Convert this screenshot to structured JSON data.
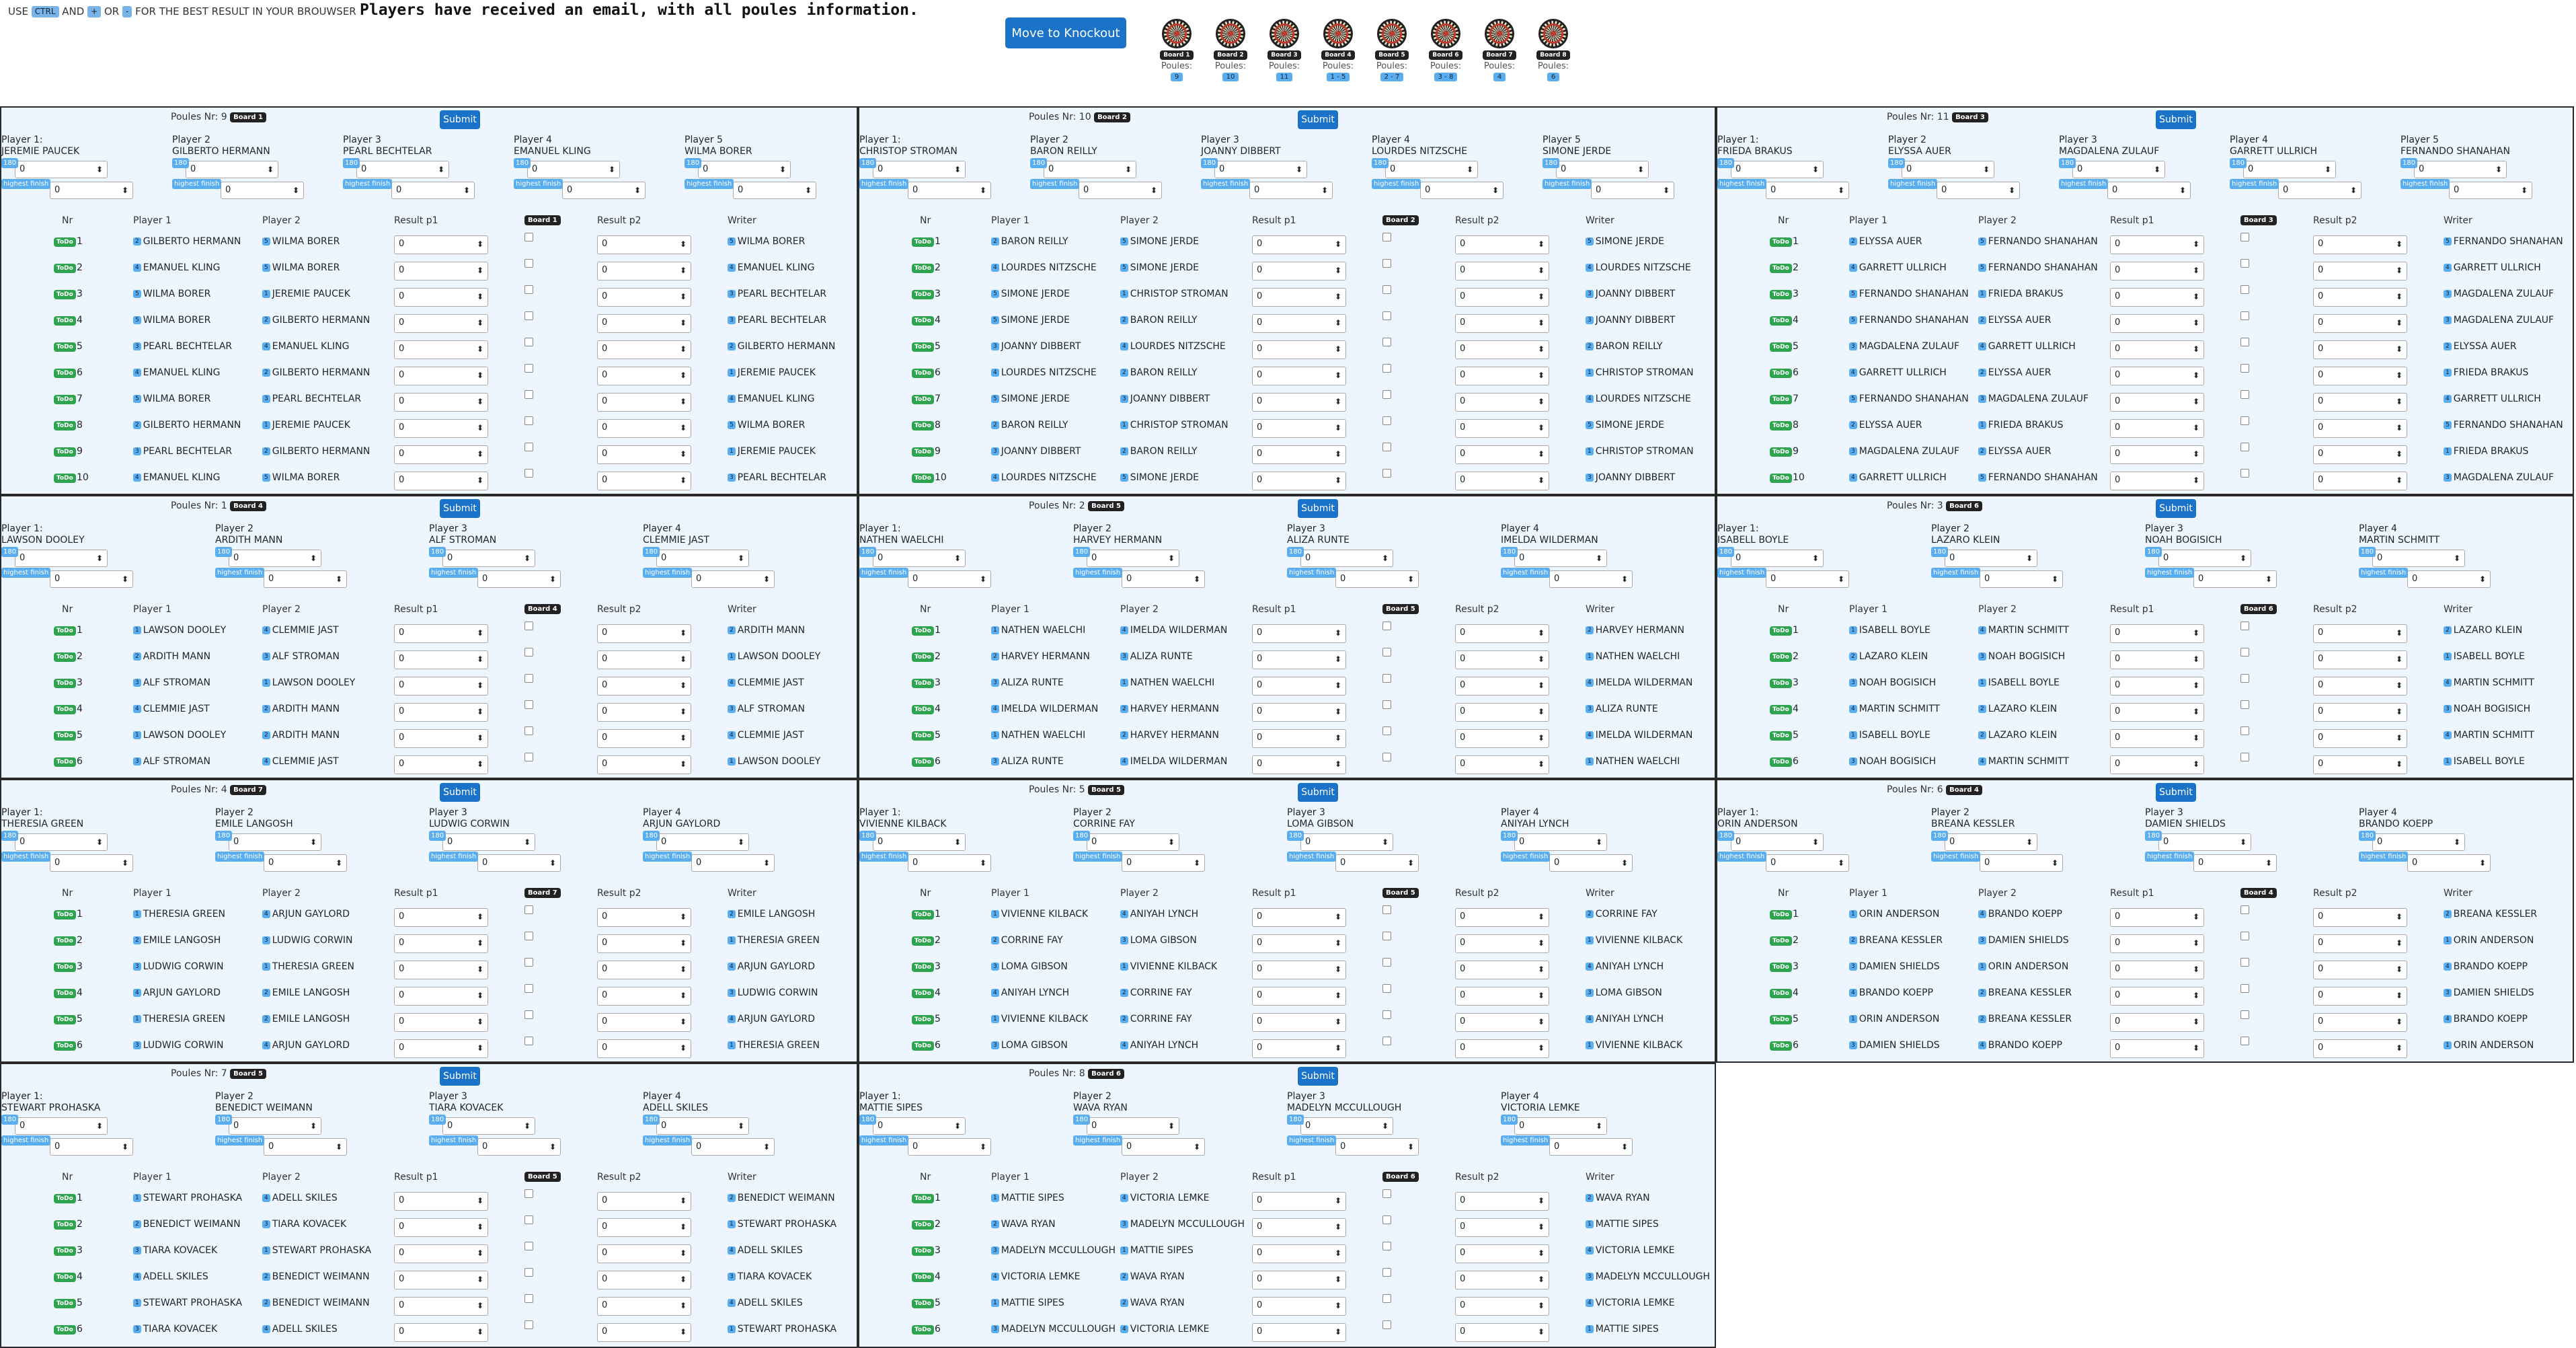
{
  "topbar": {
    "hint_use": "USE",
    "hint_key1": "CTRL",
    "hint_and": "AND",
    "hint_key2": "+",
    "hint_or": "OR",
    "hint_key3": "-",
    "hint_rest": "FOR THE BEST RESULT IN YOUR BROUWSER",
    "notice": "Players have received an email, with all poules information.",
    "move_button": "Move to Knockout"
  },
  "boards": [
    {
      "name": "Board 1",
      "label": "Poules:",
      "poules": "9"
    },
    {
      "name": "Board 2",
      "label": "Poules:",
      "poules": "10"
    },
    {
      "name": "Board 3",
      "label": "Poules:",
      "poules": "11"
    },
    {
      "name": "Board 4",
      "label": "Poules:",
      "poules": "1 - 5"
    },
    {
      "name": "Board 5",
      "label": "Poules:",
      "poules": "2 - 7"
    },
    {
      "name": "Board 6",
      "label": "Poules:",
      "poules": "3 - 8"
    },
    {
      "name": "Board 7",
      "label": "Poules:",
      "poules": "4"
    },
    {
      "name": "Board 8",
      "label": "Poules:",
      "poules": "6"
    }
  ],
  "labels": {
    "poules_nr": "Poules Nr:",
    "submit": "Submit",
    "nr": "Nr",
    "player1": "Player 1",
    "player2": "Player 2",
    "result_p1": "Result p1",
    "result_p2": "Result p2",
    "writer": "Writer",
    "s180": "180",
    "highest_finish": "highest finish",
    "todo": "ToDo",
    "zero": "0"
  },
  "poules": [
    {
      "nr": "9",
      "board": "Board 1",
      "players": [
        "JEREMIE PAUCEK",
        "GILBERTO HERMANN",
        "PEARL BECHTELAR",
        "EMANUEL KLING",
        "WILMA BORER"
      ],
      "matches": [
        [
          1,
          2,
          5,
          5
        ],
        [
          2,
          4,
          5,
          4
        ],
        [
          3,
          5,
          1,
          3
        ],
        [
          4,
          5,
          2,
          3
        ],
        [
          5,
          3,
          4,
          2
        ],
        [
          6,
          4,
          2,
          1
        ],
        [
          7,
          5,
          3,
          4
        ],
        [
          8,
          2,
          1,
          5
        ],
        [
          9,
          3,
          2,
          1
        ],
        [
          10,
          4,
          5,
          3
        ]
      ]
    },
    {
      "nr": "10",
      "board": "Board 2",
      "players": [
        "CHRISTOP STROMAN",
        "BARON REILLY",
        "JOANNY DIBBERT",
        "LOURDES NITZSCHE",
        "SIMONE JERDE"
      ],
      "matches": [
        [
          1,
          2,
          5,
          5
        ],
        [
          2,
          4,
          5,
          4
        ],
        [
          3,
          5,
          1,
          3
        ],
        [
          4,
          5,
          2,
          3
        ],
        [
          5,
          3,
          4,
          2
        ],
        [
          6,
          4,
          2,
          1
        ],
        [
          7,
          5,
          3,
          4
        ],
        [
          8,
          2,
          1,
          5
        ],
        [
          9,
          3,
          2,
          1
        ],
        [
          10,
          4,
          5,
          3
        ]
      ]
    },
    {
      "nr": "11",
      "board": "Board 3",
      "players": [
        "FRIEDA BRAKUS",
        "ELYSSA AUER",
        "MAGDALENA ZULAUF",
        "GARRETT ULLRICH",
        "FERNANDO SHANAHAN"
      ],
      "matches": [
        [
          1,
          2,
          5,
          5
        ],
        [
          2,
          4,
          5,
          4
        ],
        [
          3,
          5,
          1,
          3
        ],
        [
          4,
          5,
          2,
          3
        ],
        [
          5,
          3,
          4,
          2
        ],
        [
          6,
          4,
          2,
          1
        ],
        [
          7,
          5,
          3,
          4
        ],
        [
          8,
          2,
          1,
          5
        ],
        [
          9,
          3,
          2,
          1
        ],
        [
          10,
          4,
          5,
          3
        ]
      ]
    },
    {
      "nr": "1",
      "board": "Board 4",
      "players": [
        "LAWSON DOOLEY",
        "ARDITH MANN",
        "ALF STROMAN",
        "CLEMMIE JAST"
      ],
      "matches": [
        [
          1,
          1,
          4,
          2
        ],
        [
          2,
          2,
          3,
          1
        ],
        [
          3,
          3,
          1,
          4
        ],
        [
          4,
          4,
          2,
          3
        ],
        [
          5,
          1,
          2,
          4
        ],
        [
          6,
          3,
          4,
          1
        ]
      ]
    },
    {
      "nr": "2",
      "board": "Board 5",
      "players": [
        "NATHEN WAELCHI",
        "HARVEY HERMANN",
        "ALIZA RUNTE",
        "IMELDA WILDERMAN"
      ],
      "matches": [
        [
          1,
          1,
          4,
          2
        ],
        [
          2,
          2,
          3,
          1
        ],
        [
          3,
          3,
          1,
          4
        ],
        [
          4,
          4,
          2,
          3
        ],
        [
          5,
          1,
          2,
          4
        ],
        [
          6,
          3,
          4,
          1
        ]
      ]
    },
    {
      "nr": "3",
      "board": "Board 6",
      "players": [
        "ISABELL BOYLE",
        "LAZARO KLEIN",
        "NOAH BOGISICH",
        "MARTIN SCHMITT"
      ],
      "matches": [
        [
          1,
          1,
          4,
          2
        ],
        [
          2,
          2,
          3,
          1
        ],
        [
          3,
          3,
          1,
          4
        ],
        [
          4,
          4,
          2,
          3
        ],
        [
          5,
          1,
          2,
          4
        ],
        [
          6,
          3,
          4,
          1
        ]
      ]
    },
    {
      "nr": "4",
      "board": "Board 7",
      "players": [
        "THERESIA GREEN",
        "EMILE LANGOSH",
        "LUDWIG CORWIN",
        "ARJUN GAYLORD"
      ],
      "matches": [
        [
          1,
          1,
          4,
          2
        ],
        [
          2,
          2,
          3,
          1
        ],
        [
          3,
          3,
          1,
          4
        ],
        [
          4,
          4,
          2,
          3
        ],
        [
          5,
          1,
          2,
          4
        ],
        [
          6,
          3,
          4,
          1
        ]
      ]
    },
    {
      "nr": "5",
      "board": "Board 5",
      "players": [
        "VIVIENNE KILBACK",
        "CORRINE FAY",
        "LOMA GIBSON",
        "ANIYAH LYNCH"
      ],
      "matches": [
        [
          1,
          1,
          4,
          2
        ],
        [
          2,
          2,
          3,
          1
        ],
        [
          3,
          3,
          1,
          4
        ],
        [
          4,
          4,
          2,
          3
        ],
        [
          5,
          1,
          2,
          4
        ],
        [
          6,
          3,
          4,
          1
        ]
      ]
    },
    {
      "nr": "6",
      "board": "Board 4",
      "players": [
        "ORIN ANDERSON",
        "BREANA KESSLER",
        "DAMIEN SHIELDS",
        "BRANDO KOEPP"
      ],
      "matches": [
        [
          1,
          1,
          4,
          2
        ],
        [
          2,
          2,
          3,
          1
        ],
        [
          3,
          3,
          1,
          4
        ],
        [
          4,
          4,
          2,
          3
        ],
        [
          5,
          1,
          2,
          4
        ],
        [
          6,
          3,
          4,
          1
        ]
      ]
    },
    {
      "nr": "7",
      "board": "Board 5",
      "players": [
        "STEWART PROHASKA",
        "BENEDICT WEIMANN",
        "TIARA KOVACEK",
        "ADELL SKILES"
      ],
      "matches": [
        [
          1,
          1,
          4,
          2
        ],
        [
          2,
          2,
          3,
          1
        ],
        [
          3,
          3,
          1,
          4
        ],
        [
          4,
          4,
          2,
          3
        ],
        [
          5,
          1,
          2,
          4
        ],
        [
          6,
          3,
          4,
          1
        ]
      ]
    },
    {
      "nr": "8",
      "board": "Board 6",
      "players": [
        "MATTIE SIPES",
        "WAVA RYAN",
        "MADELYN MCCULLOUGH",
        "VICTORIA LEMKE"
      ],
      "matches": [
        [
          1,
          1,
          4,
          2
        ],
        [
          2,
          2,
          3,
          1
        ],
        [
          3,
          3,
          1,
          4
        ],
        [
          4,
          4,
          2,
          3
        ],
        [
          5,
          1,
          2,
          4
        ],
        [
          6,
          3,
          4,
          1
        ]
      ]
    }
  ]
}
